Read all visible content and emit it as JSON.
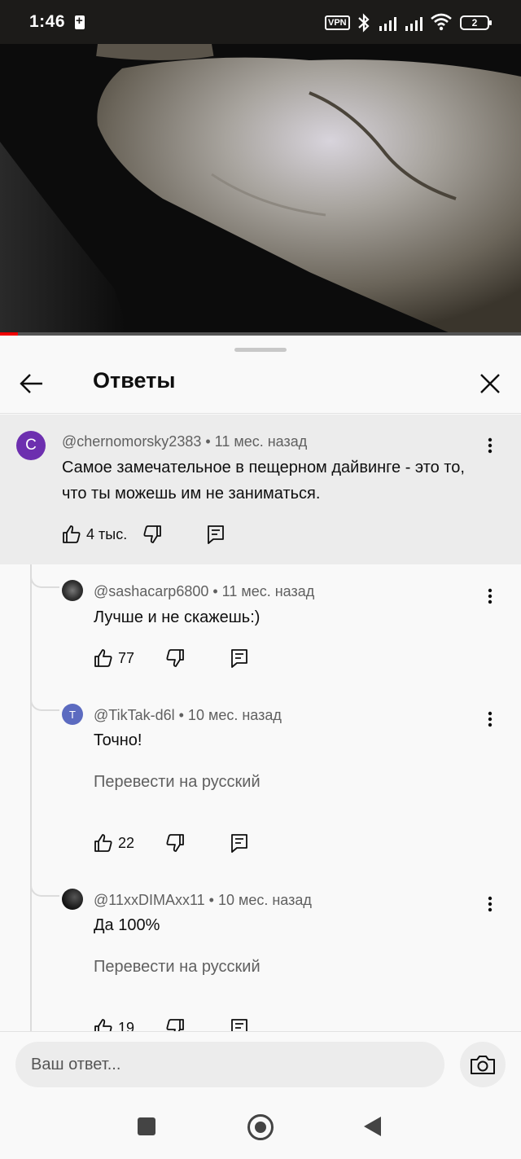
{
  "status_bar": {
    "time": "1:46",
    "vpn": "VPN",
    "battery": "2"
  },
  "video": {
    "progress": 0.035
  },
  "sheet": {
    "title": "Ответы",
    "icons": {
      "back": "arrow-left-icon",
      "close": "close-icon"
    }
  },
  "parent_comment": {
    "avatar_letter": "C",
    "avatar_color": "#6d2faf",
    "meta": "@chernomorsky2383 • 11 мес. назад",
    "text": "Самое замечательное в пещерном дайвинге - это то, что ты можешь им не заниматься.",
    "likes": "4 тыс."
  },
  "replies": [
    {
      "meta": "@sashacarp6800 • 11 мес. назад",
      "text": "Лучше и не скажешь:)",
      "likes": "77"
    },
    {
      "avatar_letter": "T",
      "avatar_color": "#5c6bc0",
      "meta": "@TikTak-d6l • 10 мес. назад",
      "text": "Точно!",
      "translate": "Перевести на русский",
      "likes": "22"
    },
    {
      "meta": "@11xxDIMAxx11 • 10 мес. назад",
      "text": "Да 100%",
      "translate": "Перевести на русский",
      "likes": "19"
    }
  ],
  "reply_input": {
    "placeholder": "Ваш ответ..."
  },
  "colors": {
    "accent_progress": "#ee0000",
    "background": "#f9f9f9"
  }
}
